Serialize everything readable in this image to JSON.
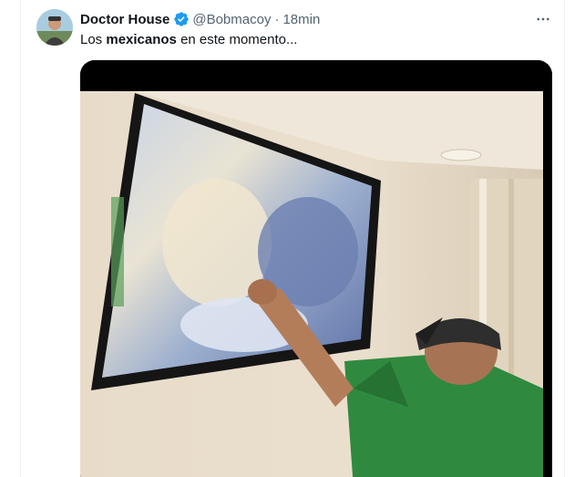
{
  "author": {
    "display_name": "Doctor House",
    "handle": "@Bobmacoy",
    "separator": "·",
    "time_ago": "18min",
    "verified": true
  },
  "tweet": {
    "text_before": "Los ",
    "text_bold": "mexicanos",
    "text_after": " en este momento..."
  },
  "media": {
    "description_icon": "video-thumbnail",
    "type": "video"
  },
  "colors": {
    "verified_blue": "#1d9bf0",
    "text_secondary": "#536471",
    "text_primary": "#0f1419",
    "shirt_green": "#2f8a3f"
  }
}
